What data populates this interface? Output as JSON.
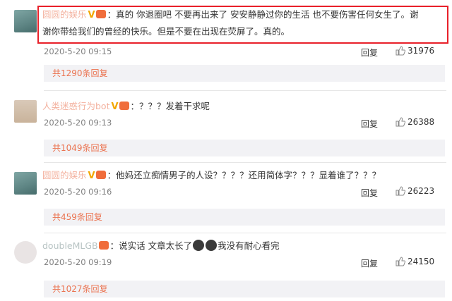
{
  "comments": [
    {
      "username": "圆圆的娱乐",
      "text_line1": "：真的 你退圈吧 不要再出来了 安安静静过你的生活 也不要伤害任何女生了。谢",
      "text_line2": "谢你带给我们的曾经的快乐。但是不要在出现在荧屏了。真的。",
      "time": "2020-5-20 09:15",
      "reply_label": "回复",
      "likes": "31976",
      "replies_link": "共1290条回复",
      "highlighted": true
    },
    {
      "username": "人类迷惑行为bot",
      "text_line1": "：？？？发着干求呢",
      "time": "2020-5-20 09:13",
      "reply_label": "回复",
      "likes": "26388",
      "replies_link": "共1049条回复"
    },
    {
      "username": "圆圆的娱乐",
      "text_line1": "：他妈还立痴情男子的人设？？？？还用简体字？？？显着谁了？？？",
      "time": "2020-5-20 09:16",
      "reply_label": "回复",
      "likes": "26223",
      "replies_link": "共459条回复"
    },
    {
      "username": "doubleMLGB",
      "text_line1_a": "：说实话 文章太长了",
      "text_line1_b": "我没有耐心看完",
      "time": "2020-5-20 09:19",
      "reply_label": "回复",
      "likes": "24150",
      "replies_link": "共1027条回复"
    }
  ],
  "colors": {
    "link_orange": "#eb7350",
    "highlight_red": "#e8202a",
    "reply_bg": "#f2f2f5"
  },
  "icons": {
    "like": "thumbs-up-icon",
    "verified": "v-badge-icon",
    "fan_badge": "fan-badge-icon"
  }
}
